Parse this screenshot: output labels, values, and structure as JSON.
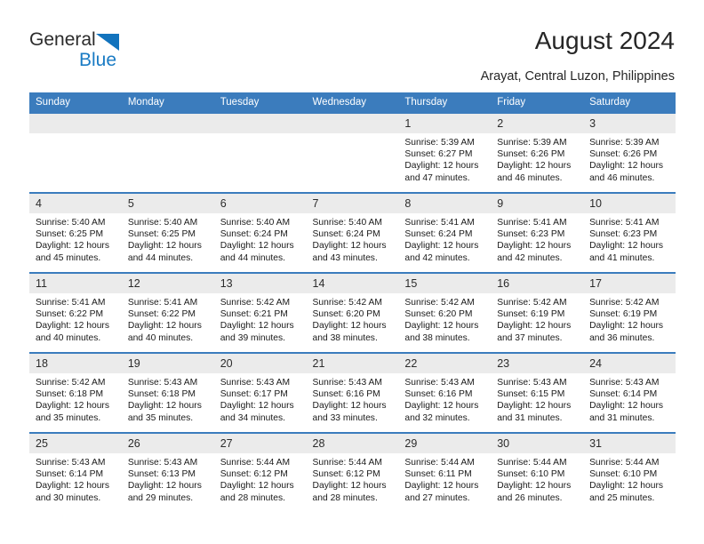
{
  "logo": {
    "word1": "General",
    "word2": "Blue",
    "triangle_color": "#1273bd",
    "blue_color": "#1a7bc4"
  },
  "header": {
    "title": "August 2024",
    "subtitle": "Arayat, Central Luzon, Philippines"
  },
  "theme": {
    "header_blue": "#3b7cbd",
    "daynum_band": "#ebebeb",
    "text": "#1a1a1a"
  },
  "weekday_headers": [
    "Sunday",
    "Monday",
    "Tuesday",
    "Wednesday",
    "Thursday",
    "Friday",
    "Saturday"
  ],
  "weeks": [
    [
      {
        "day": "",
        "sunrise": "",
        "sunset": "",
        "daylight1": "",
        "daylight2": ""
      },
      {
        "day": "",
        "sunrise": "",
        "sunset": "",
        "daylight1": "",
        "daylight2": ""
      },
      {
        "day": "",
        "sunrise": "",
        "sunset": "",
        "daylight1": "",
        "daylight2": ""
      },
      {
        "day": "",
        "sunrise": "",
        "sunset": "",
        "daylight1": "",
        "daylight2": ""
      },
      {
        "day": "1",
        "sunrise": "Sunrise: 5:39 AM",
        "sunset": "Sunset: 6:27 PM",
        "daylight1": "Daylight: 12 hours",
        "daylight2": "and 47 minutes."
      },
      {
        "day": "2",
        "sunrise": "Sunrise: 5:39 AM",
        "sunset": "Sunset: 6:26 PM",
        "daylight1": "Daylight: 12 hours",
        "daylight2": "and 46 minutes."
      },
      {
        "day": "3",
        "sunrise": "Sunrise: 5:39 AM",
        "sunset": "Sunset: 6:26 PM",
        "daylight1": "Daylight: 12 hours",
        "daylight2": "and 46 minutes."
      }
    ],
    [
      {
        "day": "4",
        "sunrise": "Sunrise: 5:40 AM",
        "sunset": "Sunset: 6:25 PM",
        "daylight1": "Daylight: 12 hours",
        "daylight2": "and 45 minutes."
      },
      {
        "day": "5",
        "sunrise": "Sunrise: 5:40 AM",
        "sunset": "Sunset: 6:25 PM",
        "daylight1": "Daylight: 12 hours",
        "daylight2": "and 44 minutes."
      },
      {
        "day": "6",
        "sunrise": "Sunrise: 5:40 AM",
        "sunset": "Sunset: 6:24 PM",
        "daylight1": "Daylight: 12 hours",
        "daylight2": "and 44 minutes."
      },
      {
        "day": "7",
        "sunrise": "Sunrise: 5:40 AM",
        "sunset": "Sunset: 6:24 PM",
        "daylight1": "Daylight: 12 hours",
        "daylight2": "and 43 minutes."
      },
      {
        "day": "8",
        "sunrise": "Sunrise: 5:41 AM",
        "sunset": "Sunset: 6:24 PM",
        "daylight1": "Daylight: 12 hours",
        "daylight2": "and 42 minutes."
      },
      {
        "day": "9",
        "sunrise": "Sunrise: 5:41 AM",
        "sunset": "Sunset: 6:23 PM",
        "daylight1": "Daylight: 12 hours",
        "daylight2": "and 42 minutes."
      },
      {
        "day": "10",
        "sunrise": "Sunrise: 5:41 AM",
        "sunset": "Sunset: 6:23 PM",
        "daylight1": "Daylight: 12 hours",
        "daylight2": "and 41 minutes."
      }
    ],
    [
      {
        "day": "11",
        "sunrise": "Sunrise: 5:41 AM",
        "sunset": "Sunset: 6:22 PM",
        "daylight1": "Daylight: 12 hours",
        "daylight2": "and 40 minutes."
      },
      {
        "day": "12",
        "sunrise": "Sunrise: 5:41 AM",
        "sunset": "Sunset: 6:22 PM",
        "daylight1": "Daylight: 12 hours",
        "daylight2": "and 40 minutes."
      },
      {
        "day": "13",
        "sunrise": "Sunrise: 5:42 AM",
        "sunset": "Sunset: 6:21 PM",
        "daylight1": "Daylight: 12 hours",
        "daylight2": "and 39 minutes."
      },
      {
        "day": "14",
        "sunrise": "Sunrise: 5:42 AM",
        "sunset": "Sunset: 6:20 PM",
        "daylight1": "Daylight: 12 hours",
        "daylight2": "and 38 minutes."
      },
      {
        "day": "15",
        "sunrise": "Sunrise: 5:42 AM",
        "sunset": "Sunset: 6:20 PM",
        "daylight1": "Daylight: 12 hours",
        "daylight2": "and 38 minutes."
      },
      {
        "day": "16",
        "sunrise": "Sunrise: 5:42 AM",
        "sunset": "Sunset: 6:19 PM",
        "daylight1": "Daylight: 12 hours",
        "daylight2": "and 37 minutes."
      },
      {
        "day": "17",
        "sunrise": "Sunrise: 5:42 AM",
        "sunset": "Sunset: 6:19 PM",
        "daylight1": "Daylight: 12 hours",
        "daylight2": "and 36 minutes."
      }
    ],
    [
      {
        "day": "18",
        "sunrise": "Sunrise: 5:42 AM",
        "sunset": "Sunset: 6:18 PM",
        "daylight1": "Daylight: 12 hours",
        "daylight2": "and 35 minutes."
      },
      {
        "day": "19",
        "sunrise": "Sunrise: 5:43 AM",
        "sunset": "Sunset: 6:18 PM",
        "daylight1": "Daylight: 12 hours",
        "daylight2": "and 35 minutes."
      },
      {
        "day": "20",
        "sunrise": "Sunrise: 5:43 AM",
        "sunset": "Sunset: 6:17 PM",
        "daylight1": "Daylight: 12 hours",
        "daylight2": "and 34 minutes."
      },
      {
        "day": "21",
        "sunrise": "Sunrise: 5:43 AM",
        "sunset": "Sunset: 6:16 PM",
        "daylight1": "Daylight: 12 hours",
        "daylight2": "and 33 minutes."
      },
      {
        "day": "22",
        "sunrise": "Sunrise: 5:43 AM",
        "sunset": "Sunset: 6:16 PM",
        "daylight1": "Daylight: 12 hours",
        "daylight2": "and 32 minutes."
      },
      {
        "day": "23",
        "sunrise": "Sunrise: 5:43 AM",
        "sunset": "Sunset: 6:15 PM",
        "daylight1": "Daylight: 12 hours",
        "daylight2": "and 31 minutes."
      },
      {
        "day": "24",
        "sunrise": "Sunrise: 5:43 AM",
        "sunset": "Sunset: 6:14 PM",
        "daylight1": "Daylight: 12 hours",
        "daylight2": "and 31 minutes."
      }
    ],
    [
      {
        "day": "25",
        "sunrise": "Sunrise: 5:43 AM",
        "sunset": "Sunset: 6:14 PM",
        "daylight1": "Daylight: 12 hours",
        "daylight2": "and 30 minutes."
      },
      {
        "day": "26",
        "sunrise": "Sunrise: 5:43 AM",
        "sunset": "Sunset: 6:13 PM",
        "daylight1": "Daylight: 12 hours",
        "daylight2": "and 29 minutes."
      },
      {
        "day": "27",
        "sunrise": "Sunrise: 5:44 AM",
        "sunset": "Sunset: 6:12 PM",
        "daylight1": "Daylight: 12 hours",
        "daylight2": "and 28 minutes."
      },
      {
        "day": "28",
        "sunrise": "Sunrise: 5:44 AM",
        "sunset": "Sunset: 6:12 PM",
        "daylight1": "Daylight: 12 hours",
        "daylight2": "and 28 minutes."
      },
      {
        "day": "29",
        "sunrise": "Sunrise: 5:44 AM",
        "sunset": "Sunset: 6:11 PM",
        "daylight1": "Daylight: 12 hours",
        "daylight2": "and 27 minutes."
      },
      {
        "day": "30",
        "sunrise": "Sunrise: 5:44 AM",
        "sunset": "Sunset: 6:10 PM",
        "daylight1": "Daylight: 12 hours",
        "daylight2": "and 26 minutes."
      },
      {
        "day": "31",
        "sunrise": "Sunrise: 5:44 AM",
        "sunset": "Sunset: 6:10 PM",
        "daylight1": "Daylight: 12 hours",
        "daylight2": "and 25 minutes."
      }
    ]
  ]
}
